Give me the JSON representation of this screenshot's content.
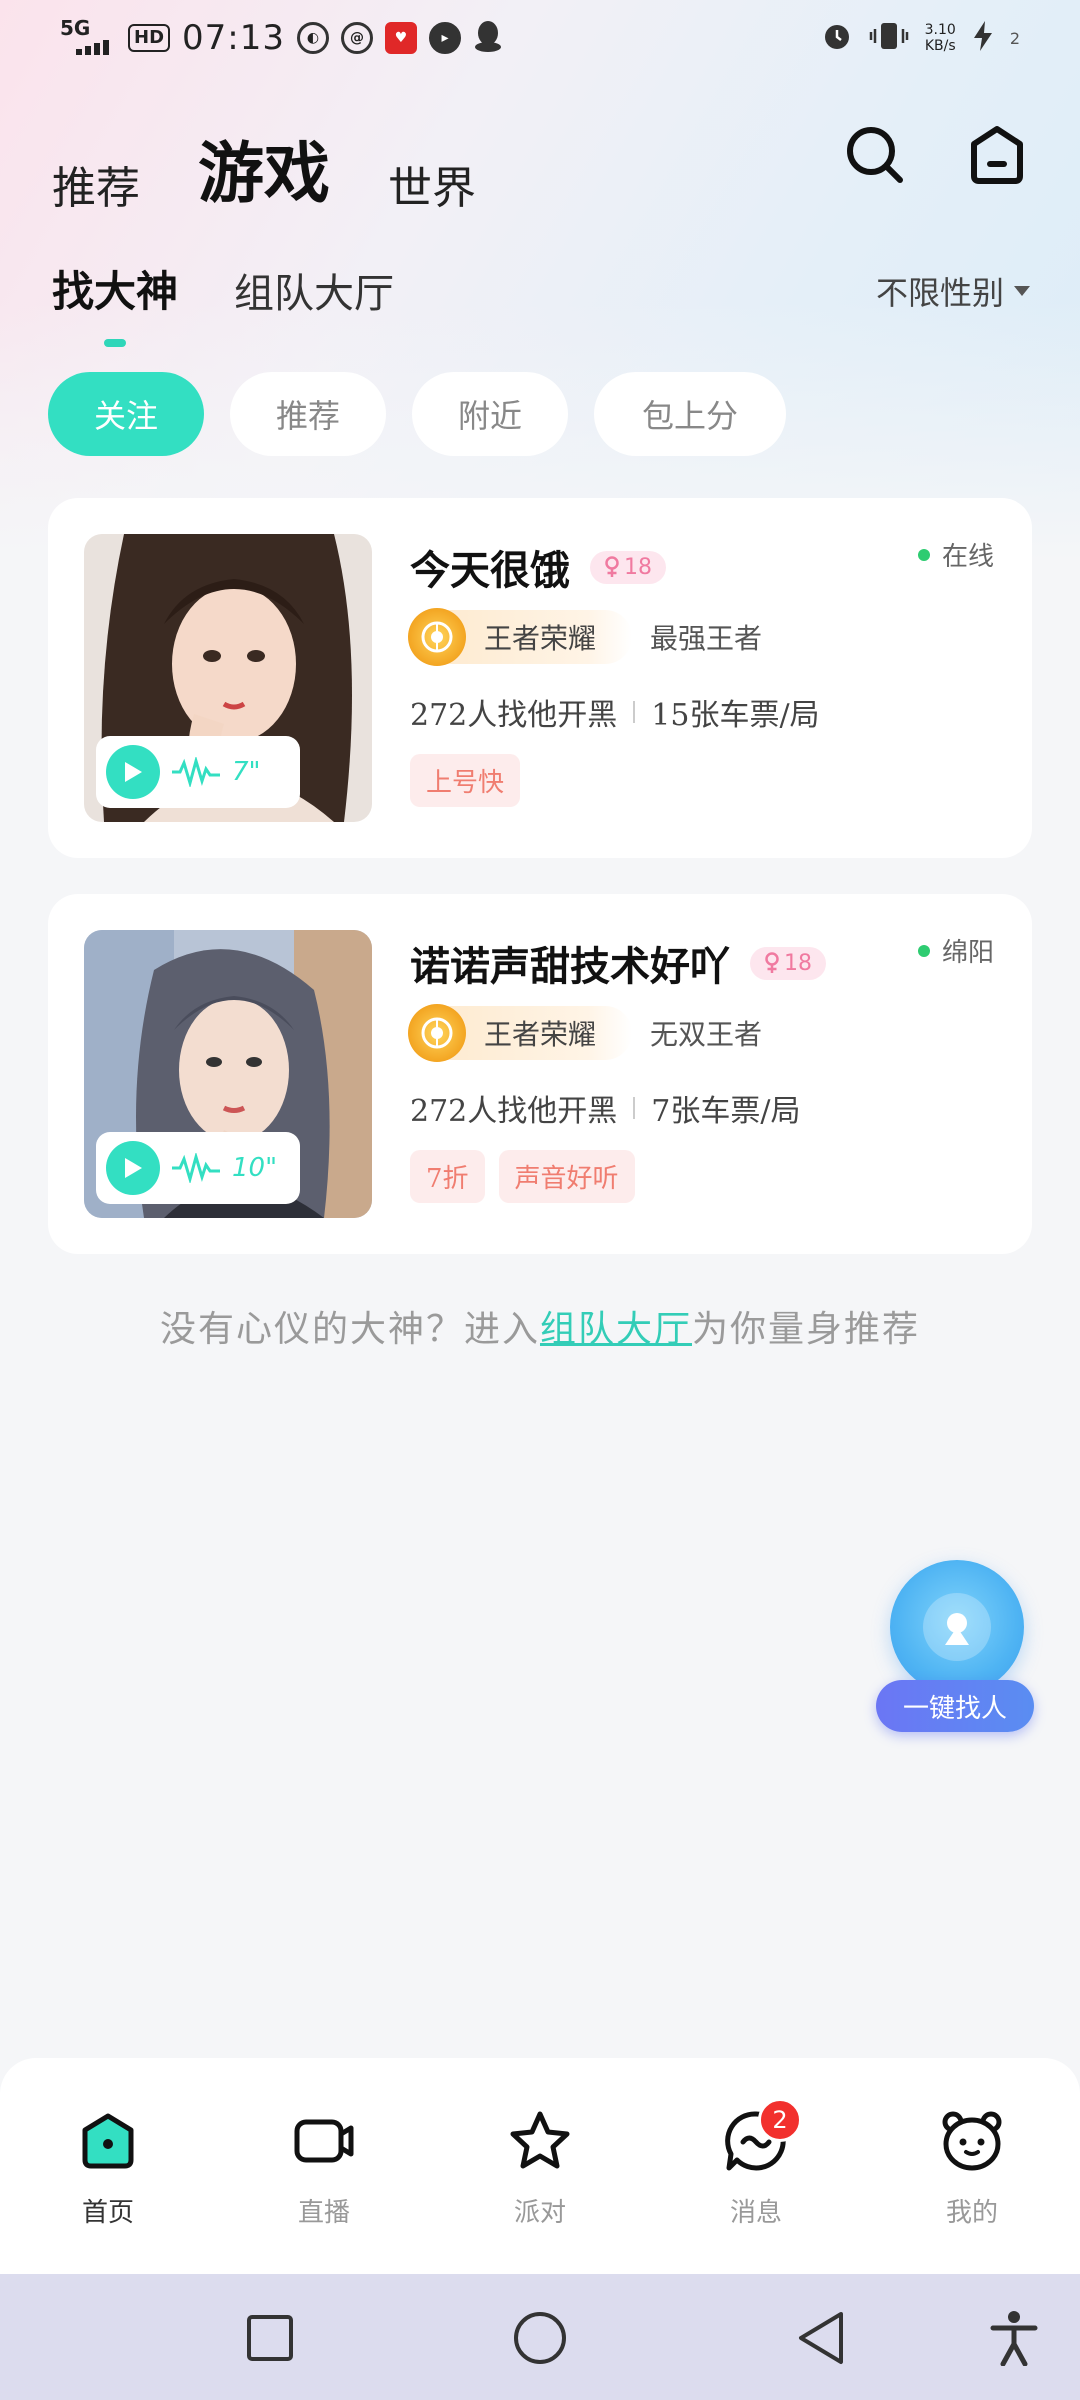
{
  "status_bar": {
    "network": "5G",
    "hd": "HD",
    "time": "07:13",
    "speed_value": "3.10",
    "speed_unit": "KB/s",
    "battery": "2"
  },
  "top_tabs": [
    {
      "label": "推荐",
      "active": false
    },
    {
      "label": "游戏",
      "active": true
    },
    {
      "label": "世界",
      "active": false
    }
  ],
  "sub_tabs": [
    {
      "label": "找大神",
      "active": true
    },
    {
      "label": "组队大厅",
      "active": false
    }
  ],
  "gender_filter": "不限性别",
  "pills": [
    {
      "label": "关注",
      "active": true
    },
    {
      "label": "推荐",
      "active": false
    },
    {
      "label": "附近",
      "active": false
    },
    {
      "label": "包上分",
      "active": false
    }
  ],
  "cards": [
    {
      "name": "今天很饿",
      "age": "18",
      "status": "在线",
      "game": "王者荣耀",
      "rank": "最强王者",
      "players": "272人找他开黑",
      "price": "15张车票/局",
      "voice_duration": "7\"",
      "tags": [
        "上号快"
      ]
    },
    {
      "name": "诺诺声甜技术好吖",
      "age": "18",
      "status": "绵阳",
      "game": "王者荣耀",
      "rank": "无双王者",
      "players": "272人找他开黑",
      "price": "7张车票/局",
      "voice_duration": "10\"",
      "tags": [
        "7折",
        "声音好听"
      ]
    }
  ],
  "hint": {
    "before": "没有心仪的大神？进入",
    "link": "组队大厅",
    "after": "为你量身推荐"
  },
  "fab_label": "一键找人",
  "bottom_nav": [
    {
      "label": "首页",
      "icon": "home-icon",
      "active": true
    },
    {
      "label": "直播",
      "icon": "live-camera-icon",
      "active": false
    },
    {
      "label": "派对",
      "icon": "party-star-icon",
      "active": false
    },
    {
      "label": "消息",
      "icon": "message-icon",
      "active": false,
      "badge": "2"
    },
    {
      "label": "我的",
      "icon": "profile-bear-icon",
      "active": false
    }
  ],
  "colors": {
    "accent": "#33dfc2",
    "badge": "#f2302d",
    "fab": "#4fb4f3"
  }
}
